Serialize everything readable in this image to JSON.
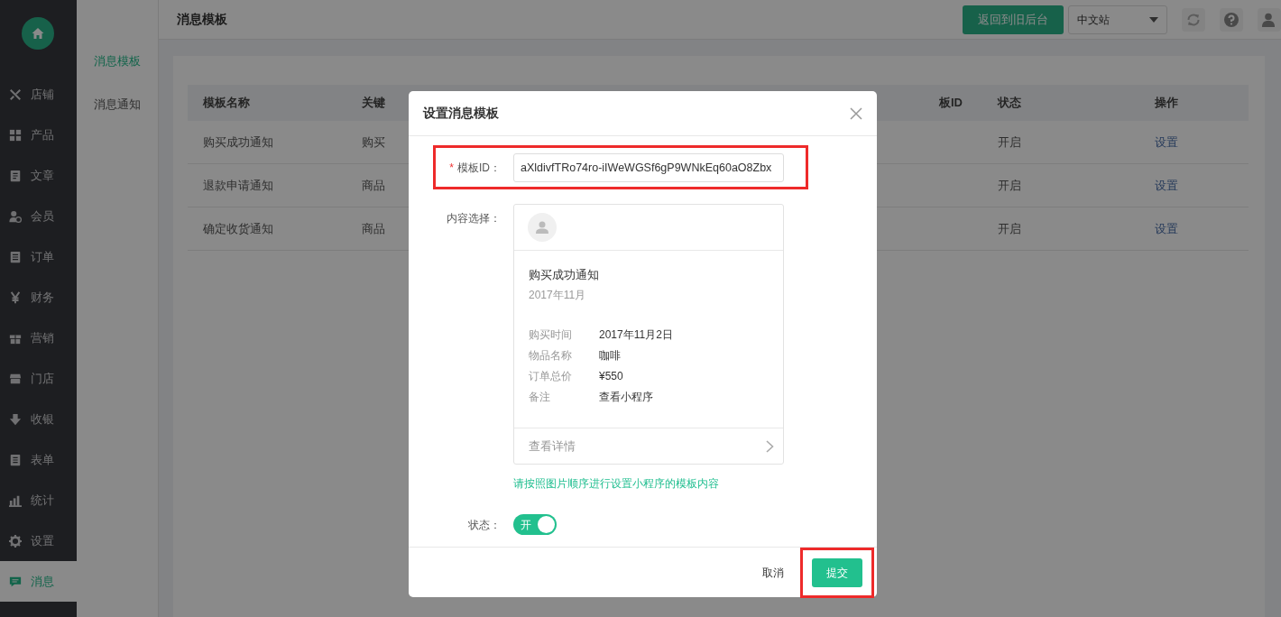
{
  "sidebar": {
    "items": [
      {
        "label": "店铺",
        "selected": false
      },
      {
        "label": "产品",
        "selected": false
      },
      {
        "label": "文章",
        "selected": false
      },
      {
        "label": "会员",
        "selected": false
      },
      {
        "label": "订单",
        "selected": false
      },
      {
        "label": "财务",
        "selected": false
      },
      {
        "label": "营销",
        "selected": false
      },
      {
        "label": "门店",
        "selected": false
      },
      {
        "label": "收银",
        "selected": false
      },
      {
        "label": "表单",
        "selected": false
      },
      {
        "label": "统计",
        "selected": false
      },
      {
        "label": "设置",
        "selected": false
      },
      {
        "label": "消息",
        "selected": true
      }
    ]
  },
  "subnav": [
    {
      "label": "消息模板",
      "selected": true
    },
    {
      "label": "消息通知",
      "selected": false
    }
  ],
  "header": {
    "title": "消息模板",
    "back_button": "返回到旧后台",
    "site_select": "中文站"
  },
  "table": {
    "columns": [
      "模板名称",
      "关键",
      "板ID",
      "状态",
      "操作"
    ],
    "rows": [
      {
        "name": "购买成功通知",
        "keywords": "购买",
        "status": "开启",
        "action": "设置"
      },
      {
        "name": "退款申请通知",
        "keywords": "商品",
        "status": "开启",
        "action": "设置"
      },
      {
        "name": "确定收货通知",
        "keywords": "商品",
        "status": "开启",
        "action": "设置"
      }
    ]
  },
  "dialog": {
    "title": "设置消息模板",
    "template_id": {
      "required_mark": "*",
      "label": "模板ID：",
      "value": "aXldivfTRo74ro-iIWeWGSf6gP9WNkEq60aO8Zbx"
    },
    "content": {
      "label": "内容选择：",
      "preview": {
        "title": "购买成功通知",
        "date": "2017年11月",
        "fields": [
          {
            "label": "购买时间",
            "value": "2017年11月2日"
          },
          {
            "label": "物品名称",
            "value": "咖啡"
          },
          {
            "label": "订单总价",
            "value": "¥550"
          },
          {
            "label": "备注",
            "value": "查看小程序"
          }
        ],
        "footer": "查看详情"
      },
      "hint": "请按照图片顺序进行设置小程序的模板内容"
    },
    "status": {
      "label": "状态：",
      "on": true,
      "on_text": "开"
    },
    "buttons": {
      "cancel": "取消",
      "submit": "提交"
    }
  }
}
